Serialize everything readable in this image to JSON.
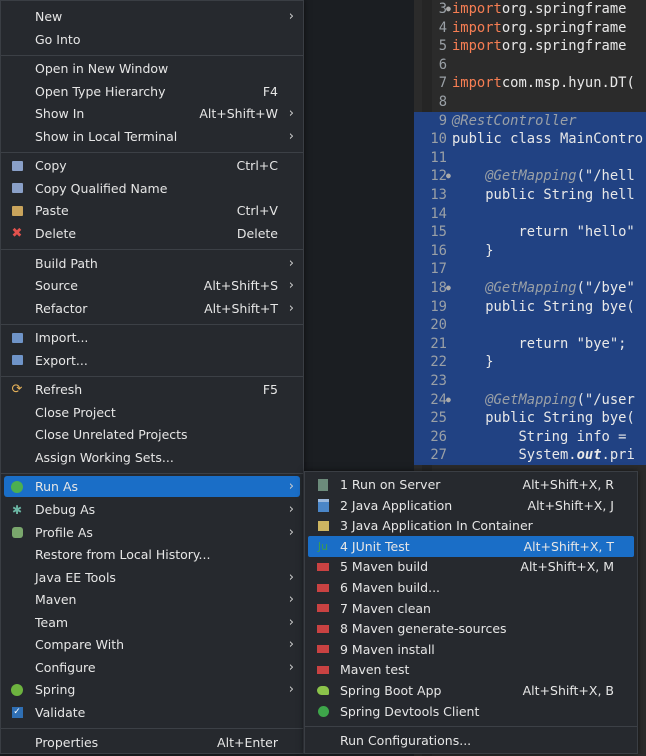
{
  "editor": {
    "lines": [
      {
        "num": "3",
        "parts": [
          [
            "kw",
            "import"
          ],
          [
            "",
            "org.springframe"
          ]
        ],
        "sel": false,
        "dot": true
      },
      {
        "num": "4",
        "parts": [
          [
            "kw",
            "import"
          ],
          [
            "",
            "org.springframe"
          ]
        ],
        "sel": false,
        "dot": false
      },
      {
        "num": "5",
        "parts": [
          [
            "kw",
            "import"
          ],
          [
            "",
            "org.springframe"
          ]
        ],
        "sel": false,
        "dot": false
      },
      {
        "num": "6",
        "parts": [],
        "sel": false,
        "dot": false
      },
      {
        "num": "7",
        "parts": [
          [
            "kw",
            "import"
          ],
          [
            "",
            "com.msp.hyun.DT("
          ]
        ],
        "sel": false,
        "dot": false
      },
      {
        "num": "8",
        "parts": [],
        "sel": false,
        "dot": false
      },
      {
        "num": "9",
        "parts": [
          [
            "ann",
            "@RestController"
          ]
        ],
        "sel": true,
        "dot": false
      },
      {
        "num": "10",
        "parts": [
          [
            "",
            "public class MainContro"
          ]
        ],
        "sel": true,
        "dot": false
      },
      {
        "num": "11",
        "parts": [],
        "sel": true,
        "dot": false
      },
      {
        "num": "12",
        "parts": [
          [
            "ann",
            "    @GetMapping"
          ],
          [
            "",
            "(\"/hell"
          ]
        ],
        "sel": true,
        "dot": true
      },
      {
        "num": "13",
        "parts": [
          [
            "",
            "    public String hell"
          ]
        ],
        "sel": true,
        "dot": false
      },
      {
        "num": "14",
        "parts": [],
        "sel": true,
        "dot": false
      },
      {
        "num": "15",
        "parts": [
          [
            "",
            "        return \"hello\""
          ]
        ],
        "sel": true,
        "dot": false
      },
      {
        "num": "16",
        "parts": [
          [
            "",
            "    }"
          ]
        ],
        "sel": true,
        "dot": false
      },
      {
        "num": "17",
        "parts": [],
        "sel": true,
        "dot": false
      },
      {
        "num": "18",
        "parts": [
          [
            "ann",
            "    @GetMapping"
          ],
          [
            "",
            "(\"/bye\""
          ]
        ],
        "sel": true,
        "dot": true
      },
      {
        "num": "19",
        "parts": [
          [
            "",
            "    public String bye("
          ]
        ],
        "sel": true,
        "dot": false
      },
      {
        "num": "20",
        "parts": [],
        "sel": true,
        "dot": false
      },
      {
        "num": "21",
        "parts": [
          [
            "",
            "        return \"bye\";"
          ]
        ],
        "sel": true,
        "dot": false
      },
      {
        "num": "22",
        "parts": [
          [
            "",
            "    }"
          ]
        ],
        "sel": true,
        "dot": false
      },
      {
        "num": "23",
        "parts": [],
        "sel": true,
        "dot": false
      },
      {
        "num": "24",
        "parts": [
          [
            "ann",
            "    @GetMapping"
          ],
          [
            "",
            "(\"/user"
          ]
        ],
        "sel": true,
        "dot": true
      },
      {
        "num": "25",
        "parts": [
          [
            "",
            "    public String bye("
          ]
        ],
        "sel": true,
        "dot": false
      },
      {
        "num": "26",
        "parts": [
          [
            "",
            "        String info ="
          ]
        ],
        "sel": true,
        "dot": false
      },
      {
        "num": "27",
        "parts": [
          [
            "",
            "        System."
          ],
          [
            "bi",
            "out"
          ],
          [
            "",
            ".pri"
          ]
        ],
        "sel": true,
        "dot": false
      }
    ]
  },
  "context_menu": {
    "items": [
      {
        "type": "item",
        "name": "menu-item-new",
        "label": "New",
        "arrow": true,
        "icon": ""
      },
      {
        "type": "item",
        "name": "menu-item-go-into",
        "label": "Go Into",
        "icon": ""
      },
      {
        "type": "sep"
      },
      {
        "type": "item",
        "name": "menu-item-open-new-window",
        "label": "Open in New Window",
        "icon": ""
      },
      {
        "type": "item",
        "name": "menu-item-open-type-hierarchy",
        "label": "Open Type Hierarchy",
        "shortcut": "F4",
        "icon": ""
      },
      {
        "type": "item",
        "name": "menu-item-show-in",
        "label": "Show In",
        "shortcut": "Alt+Shift+W",
        "arrow": true,
        "icon": ""
      },
      {
        "type": "item",
        "name": "menu-item-show-local-terminal",
        "label": "Show in Local Terminal",
        "arrow": true,
        "icon": ""
      },
      {
        "type": "sep"
      },
      {
        "type": "item",
        "name": "menu-item-copy",
        "label": "Copy",
        "shortcut": "Ctrl+C",
        "icon": "copy-icon"
      },
      {
        "type": "item",
        "name": "menu-item-copy-qualified-name",
        "label": "Copy Qualified Name",
        "icon": "copy-qualified-name-icon"
      },
      {
        "type": "item",
        "name": "menu-item-paste",
        "label": "Paste",
        "shortcut": "Ctrl+V",
        "icon": "paste-icon"
      },
      {
        "type": "item",
        "name": "menu-item-delete",
        "label": "Delete",
        "shortcut": "Delete",
        "icon": "delete-icon"
      },
      {
        "type": "sep"
      },
      {
        "type": "item",
        "name": "menu-item-build-path",
        "label": "Build Path",
        "arrow": true,
        "icon": ""
      },
      {
        "type": "item",
        "name": "menu-item-source",
        "label": "Source",
        "shortcut": "Alt+Shift+S",
        "arrow": true,
        "icon": ""
      },
      {
        "type": "item",
        "name": "menu-item-refactor",
        "label": "Refactor",
        "shortcut": "Alt+Shift+T",
        "arrow": true,
        "icon": ""
      },
      {
        "type": "sep"
      },
      {
        "type": "item",
        "name": "menu-item-import",
        "label": "Import...",
        "icon": "import-icon"
      },
      {
        "type": "item",
        "name": "menu-item-export",
        "label": "Export...",
        "icon": "export-icon"
      },
      {
        "type": "sep"
      },
      {
        "type": "item",
        "name": "menu-item-refresh",
        "label": "Refresh",
        "shortcut": "F5",
        "icon": "refresh-icon"
      },
      {
        "type": "item",
        "name": "menu-item-close-project",
        "label": "Close Project",
        "icon": ""
      },
      {
        "type": "item",
        "name": "menu-item-close-unrelated-projects",
        "label": "Close Unrelated Projects",
        "icon": ""
      },
      {
        "type": "item",
        "name": "menu-item-assign-working-sets",
        "label": "Assign Working Sets...",
        "icon": ""
      },
      {
        "type": "sep"
      },
      {
        "type": "item",
        "name": "menu-item-run-as",
        "label": "Run As",
        "arrow": true,
        "icon": "run-icon",
        "highlighted": true
      },
      {
        "type": "item",
        "name": "menu-item-debug-as",
        "label": "Debug As",
        "arrow": true,
        "icon": "debug-icon"
      },
      {
        "type": "item",
        "name": "menu-item-profile-as",
        "label": "Profile As",
        "arrow": true,
        "icon": "profile-icon"
      },
      {
        "type": "item",
        "name": "menu-item-restore-local-history",
        "label": "Restore from Local History...",
        "icon": ""
      },
      {
        "type": "item",
        "name": "menu-item-java-ee-tools",
        "label": "Java EE Tools",
        "arrow": true,
        "icon": ""
      },
      {
        "type": "item",
        "name": "menu-item-maven",
        "label": "Maven",
        "arrow": true,
        "icon": ""
      },
      {
        "type": "item",
        "name": "menu-item-team",
        "label": "Team",
        "arrow": true,
        "icon": ""
      },
      {
        "type": "item",
        "name": "menu-item-compare-with",
        "label": "Compare With",
        "arrow": true,
        "icon": ""
      },
      {
        "type": "item",
        "name": "menu-item-configure",
        "label": "Configure",
        "arrow": true,
        "icon": ""
      },
      {
        "type": "item",
        "name": "menu-item-spring",
        "label": "Spring",
        "arrow": true,
        "icon": "spring-icon"
      },
      {
        "type": "item",
        "name": "menu-item-validate",
        "label": "Validate",
        "icon": "validate-icon"
      },
      {
        "type": "sep"
      },
      {
        "type": "item",
        "name": "menu-item-properties",
        "label": "Properties",
        "shortcut": "Alt+Enter",
        "icon": ""
      }
    ]
  },
  "run_as_submenu": {
    "items": [
      {
        "type": "item",
        "name": "submenu-item-run-on-server",
        "label": "1 Run on Server",
        "shortcut": "Alt+Shift+X, R",
        "icon": "server-icon"
      },
      {
        "type": "item",
        "name": "submenu-item-java-application",
        "label": "2 Java Application",
        "shortcut": "Alt+Shift+X, J",
        "icon": "java-application-icon"
      },
      {
        "type": "item",
        "name": "submenu-item-java-app-container",
        "label": "3 Java Application In Container",
        "icon": "java-container-icon"
      },
      {
        "type": "item",
        "name": "submenu-item-junit-test",
        "label": "4 JUnit Test",
        "shortcut": "Alt+Shift+X, T",
        "icon": "junit-icon",
        "highlighted": true
      },
      {
        "type": "item",
        "name": "submenu-item-maven-build",
        "label": "5 Maven build",
        "shortcut": "Alt+Shift+X, M",
        "icon": "maven-icon"
      },
      {
        "type": "item",
        "name": "submenu-item-maven-build-dialog",
        "label": "6 Maven build...",
        "icon": "maven-icon"
      },
      {
        "type": "item",
        "name": "submenu-item-maven-clean",
        "label": "7 Maven clean",
        "icon": "maven-icon"
      },
      {
        "type": "item",
        "name": "submenu-item-maven-generate-sources",
        "label": "8 Maven generate-sources",
        "icon": "maven-icon"
      },
      {
        "type": "item",
        "name": "submenu-item-maven-install",
        "label": "9 Maven install",
        "icon": "maven-icon"
      },
      {
        "type": "item",
        "name": "submenu-item-maven-test",
        "label": "Maven test",
        "icon": "maven-icon"
      },
      {
        "type": "item",
        "name": "submenu-item-spring-boot-app",
        "label": "Spring Boot App",
        "shortcut": "Alt+Shift+X, B",
        "icon": "spring-boot-icon"
      },
      {
        "type": "item",
        "name": "submenu-item-spring-devtools-client",
        "label": "Spring Devtools Client",
        "icon": "devtools-icon"
      },
      {
        "type": "sep"
      },
      {
        "type": "item",
        "name": "submenu-item-run-configurations",
        "label": "Run Configurations...",
        "icon": ""
      }
    ]
  }
}
